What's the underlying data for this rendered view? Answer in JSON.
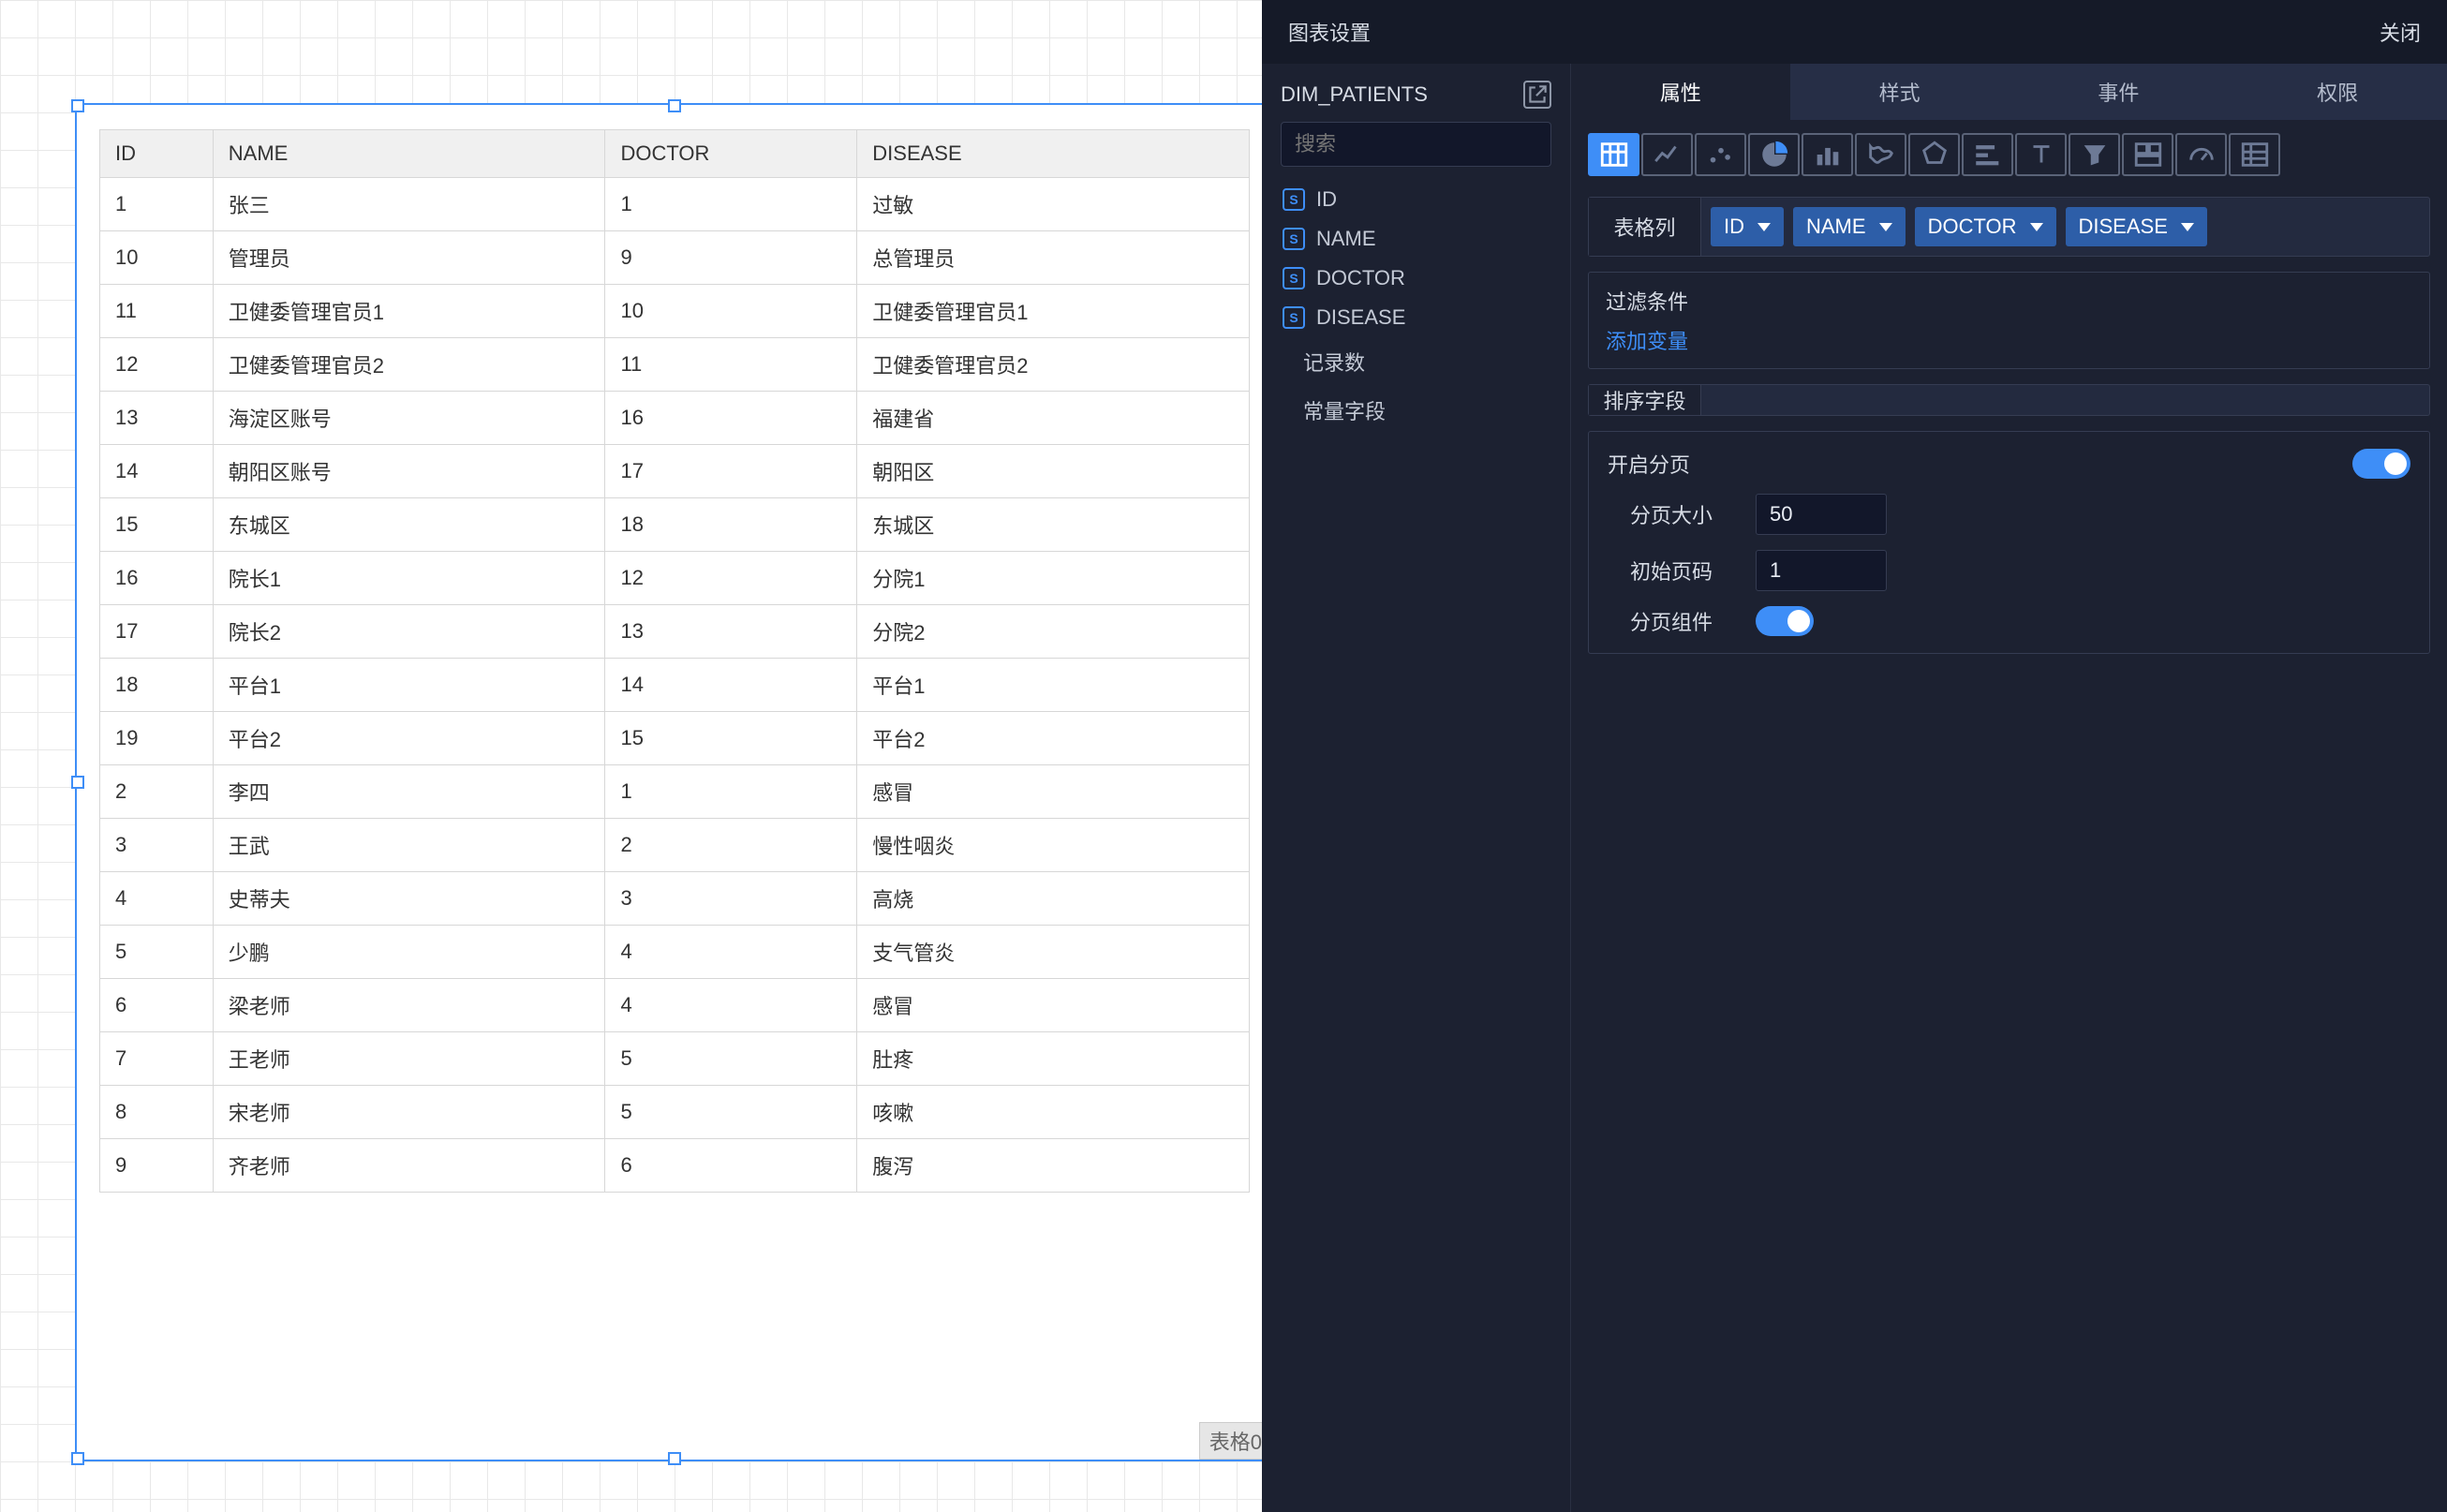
{
  "canvas": {
    "component_label": "表格0"
  },
  "table": {
    "columns": [
      "ID",
      "NAME",
      "DOCTOR",
      "DISEASE"
    ],
    "rows": [
      {
        "id": "1",
        "name": "张三",
        "doctor": "1",
        "disease": "过敏"
      },
      {
        "id": "10",
        "name": "管理员",
        "doctor": "9",
        "disease": "总管理员"
      },
      {
        "id": "11",
        "name": "卫健委管理官员1",
        "doctor": "10",
        "disease": "卫健委管理官员1"
      },
      {
        "id": "12",
        "name": "卫健委管理官员2",
        "doctor": "11",
        "disease": "卫健委管理官员2"
      },
      {
        "id": "13",
        "name": "海淀区账号",
        "doctor": "16",
        "disease": "福建省"
      },
      {
        "id": "14",
        "name": "朝阳区账号",
        "doctor": "17",
        "disease": "朝阳区"
      },
      {
        "id": "15",
        "name": "东城区",
        "doctor": "18",
        "disease": "东城区"
      },
      {
        "id": "16",
        "name": "院长1",
        "doctor": "12",
        "disease": "分院1"
      },
      {
        "id": "17",
        "name": "院长2",
        "doctor": "13",
        "disease": "分院2"
      },
      {
        "id": "18",
        "name": "平台1",
        "doctor": "14",
        "disease": "平台1"
      },
      {
        "id": "19",
        "name": "平台2",
        "doctor": "15",
        "disease": "平台2"
      },
      {
        "id": "2",
        "name": "李四",
        "doctor": "1",
        "disease": "感冒"
      },
      {
        "id": "3",
        "name": "王武",
        "doctor": "2",
        "disease": "慢性咽炎"
      },
      {
        "id": "4",
        "name": "史蒂夫",
        "doctor": "3",
        "disease": "高烧"
      },
      {
        "id": "5",
        "name": "少鹏",
        "doctor": "4",
        "disease": "支气管炎"
      },
      {
        "id": "6",
        "name": "梁老师",
        "doctor": "4",
        "disease": "感冒"
      },
      {
        "id": "7",
        "name": "王老师",
        "doctor": "5",
        "disease": "肚疼"
      },
      {
        "id": "8",
        "name": "宋老师",
        "doctor": "5",
        "disease": "咳嗽"
      },
      {
        "id": "9",
        "name": "齐老师",
        "doctor": "6",
        "disease": "腹泻"
      }
    ]
  },
  "panel": {
    "title": "图表设置",
    "close": "关闭",
    "datasource": {
      "name": "DIM_PATIENTS",
      "search_placeholder": "搜索",
      "fields": [
        "ID",
        "NAME",
        "DOCTOR",
        "DISEASE"
      ],
      "tree": {
        "record_count": "记录数",
        "constant_field": "常量字段"
      }
    },
    "tabs": {
      "attr": "属性",
      "style": "样式",
      "event": "事件",
      "perm": "权限"
    },
    "chart_types": [
      "table",
      "line",
      "scatter",
      "pie",
      "bar",
      "map",
      "radar",
      "hbar",
      "text",
      "funnel",
      "dashboard",
      "gauge",
      "pivot"
    ],
    "columns_row": {
      "label": "表格列",
      "chips": [
        "ID",
        "NAME",
        "DOCTOR",
        "DISEASE"
      ]
    },
    "filter": {
      "title": "过滤条件",
      "add": "添加变量"
    },
    "sort": {
      "label": "排序字段"
    },
    "pagination": {
      "enable_label": "开启分页",
      "enable": true,
      "page_size_label": "分页大小",
      "page_size": "50",
      "initial_page_label": "初始页码",
      "initial_page": "1",
      "pager_label": "分页组件",
      "pager": true
    }
  }
}
